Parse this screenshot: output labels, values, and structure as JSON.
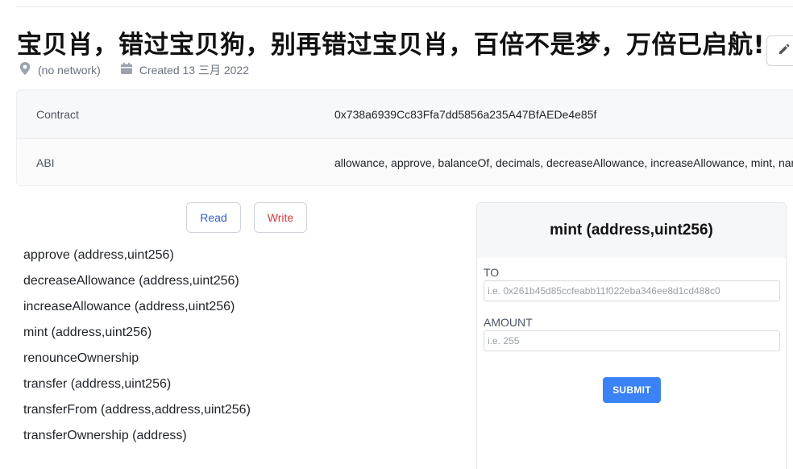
{
  "header": {
    "title": "宝贝肖，错过宝贝狗，别再错过宝贝肖，百倍不是梦，万倍已启航!",
    "network": "(no network)",
    "created": "Created 13 三月 2022"
  },
  "info": {
    "contract_label": "Contract",
    "contract_value": "0x738a6939Cc83Ffa7dd5856a235A47BfAEDe4e85f",
    "abi_label": "ABI",
    "abi_value": "allowance, approve, balanceOf, decimals, decreaseAllowance, increaseAllowance, mint, name"
  },
  "tabs": {
    "read": "Read",
    "write": "Write"
  },
  "functions": [
    "approve (address,uint256)",
    "decreaseAllowance (address,uint256)",
    "increaseAllowance (address,uint256)",
    "mint (address,uint256)",
    "renounceOwnership",
    "transfer (address,uint256)",
    "transferFrom (address,address,uint256)",
    "transferOwnership (address)"
  ],
  "form": {
    "title": "mint (address,uint256)",
    "to_label": "TO",
    "to_placeholder": "i.e. 0x261b45d85ccfeabb11f022eba346ee8d1cd488c0",
    "amount_label": "AMOUNT",
    "amount_placeholder": "i.e. 255",
    "submit": "SUBMIT"
  },
  "icons": {
    "network": "map-pin-icon",
    "created": "calendar-icon",
    "edit": "pencil-icon"
  },
  "colors": {
    "read_tab": "#2f5fc4",
    "write_tab": "#d23b3b",
    "submit": "#3b82f6"
  }
}
